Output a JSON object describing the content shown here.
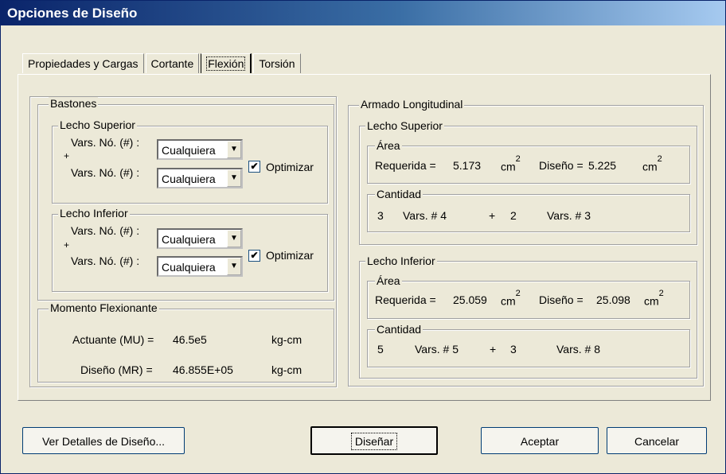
{
  "window": {
    "title": "Opciones de Diseño"
  },
  "tabs": [
    {
      "label": "Propiedades y Cargas"
    },
    {
      "label": "Cortante"
    },
    {
      "label": "Flexión",
      "active": true
    },
    {
      "label": "Torsión"
    }
  ],
  "bastones": {
    "title": "Bastones",
    "superior": {
      "title": "Lecho Superior",
      "row1_label": "Vars. Nó. (#) :",
      "row2_label": "Vars. Nó. (#) :",
      "combo1": "Cualquiera",
      "combo2": "Cualquiera",
      "plus": "+",
      "optimizar": "Optimizar",
      "optimizar_checked": true
    },
    "inferior": {
      "title": "Lecho Inferior",
      "row1_label": "Vars. Nó. (#) :",
      "row2_label": "Vars. Nó. (#) :",
      "combo1": "Cualquiera",
      "combo2": "Cualquiera",
      "plus": "+",
      "optimizar": "Optimizar",
      "optimizar_checked": true
    }
  },
  "momento": {
    "title": "Momento Flexionante",
    "actuante_label": "Actuante (MU) =",
    "actuante_value": "46.5e5",
    "actuante_unit": "kg-cm",
    "diseno_label": "Diseño (MR) =",
    "diseno_value": "46.855E+05",
    "diseno_unit": "kg-cm"
  },
  "armado": {
    "title": "Armado Longitudinal",
    "superior": {
      "title": "Lecho Superior",
      "area_title": "Área",
      "requerida_label": "Requerida =",
      "requerida_value": "5.173",
      "unit": "cm",
      "exp": "2",
      "diseno_label": "Diseño =",
      "diseno_value": "5.225",
      "cantidad_title": "Cantidad",
      "n1": "3",
      "vars1": "Vars. # 4",
      "plus": "+",
      "n2": "2",
      "vars2": "Vars. # 3"
    },
    "inferior": {
      "title": "Lecho Inferior",
      "area_title": "Área",
      "requerida_label": "Requerida =",
      "requerida_value": "25.059",
      "unit": "cm",
      "exp": "2",
      "diseno_label": "Diseño =",
      "diseno_value": "25.098",
      "cantidad_title": "Cantidad",
      "n1": "5",
      "vars1": "Vars. # 5",
      "plus": "+",
      "n2": "3",
      "vars2": "Vars. # 8"
    }
  },
  "buttons": {
    "detalles": "Ver Detalles de Diseño...",
    "disenar": "Diseñar",
    "aceptar": "Aceptar",
    "cancelar": "Cancelar"
  }
}
